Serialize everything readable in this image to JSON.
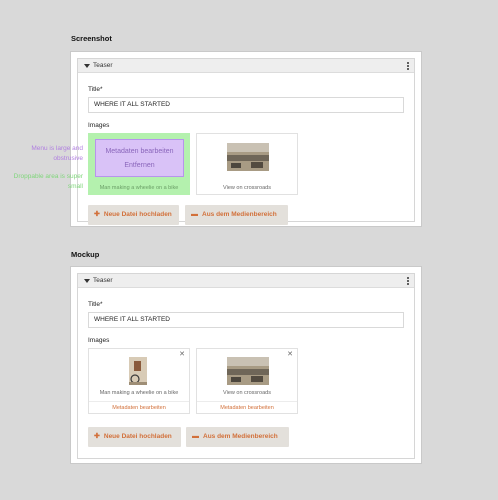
{
  "screenshot": {
    "heading": "Screenshot",
    "panel_title": "Teaser",
    "title_label": "Title*",
    "title_value": "WHERE IT ALL STARTED",
    "images_label": "Images",
    "card1_caption": "Man making a wheelie on a bike",
    "card2_caption": "View on crossroads",
    "menu_edit": "Metadaten bearbeiten",
    "menu_remove": "Entfernen",
    "upload_button": "Neue Datei hochladen",
    "media_button": "Aus dem Medienbereich"
  },
  "annotations": {
    "menu_note": "Menu is large and obstrusive",
    "drop_note": "Droppable area is super small"
  },
  "mockup": {
    "heading": "Mockup",
    "panel_title": "Teaser",
    "title_label": "Title*",
    "title_value": "WHERE IT ALL STARTED",
    "images_label": "Images",
    "card1_caption": "Man making a wheelie on a bike",
    "card1_link": "Metadaten bearbeiten",
    "card2_caption": "View on crossroads",
    "card2_link": "Metadaten bearbeiten",
    "upload_button": "Neue Datei hochladen",
    "media_button": "Aus dem Medienbereich"
  },
  "icons": {
    "plus": "plus-icon",
    "folder": "folder-icon",
    "close": "close-icon",
    "caret": "caret-down-icon",
    "kebab": "kebab-menu-icon"
  },
  "colors": {
    "accent": "#d2703a",
    "menu_purple": "#d9c2f7",
    "drop_green": "#b4f1ae",
    "note_purple": "#b07fe0",
    "note_green": "#7fd67a"
  }
}
